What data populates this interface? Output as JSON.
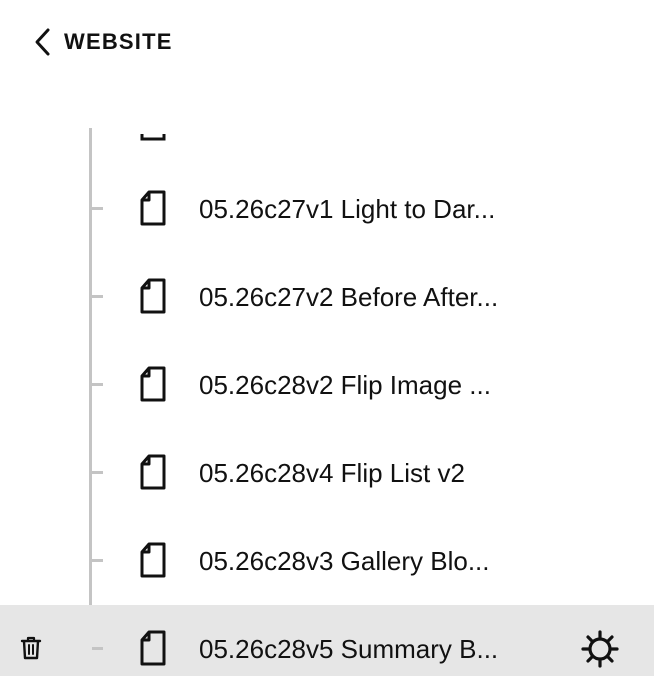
{
  "header": {
    "back_label": "WEBSITE",
    "back_icon": "chevron-left-icon"
  },
  "pages": [
    {
      "label": "05.26c27v1 Light to Dar...",
      "icon": "page-icon",
      "selected": false
    },
    {
      "label": "05.26c27v2 Before After...",
      "icon": "page-icon",
      "selected": false
    },
    {
      "label": "05.26c28v2 Flip Image ...",
      "icon": "page-icon",
      "selected": false
    },
    {
      "label": "05.26c28v4 Flip List v2",
      "icon": "page-icon",
      "selected": false
    },
    {
      "label": "05.26c28v3 Gallery Blo...",
      "icon": "page-icon",
      "selected": false
    },
    {
      "label": "05.26c28v5 Summary B...",
      "icon": "page-icon",
      "selected": true,
      "actions": [
        "trash-icon",
        "gear-icon"
      ]
    }
  ],
  "colors": {
    "selected_row_bg": "#e6e6e6",
    "tree_line": "#c4c4c4",
    "text": "#111111"
  }
}
